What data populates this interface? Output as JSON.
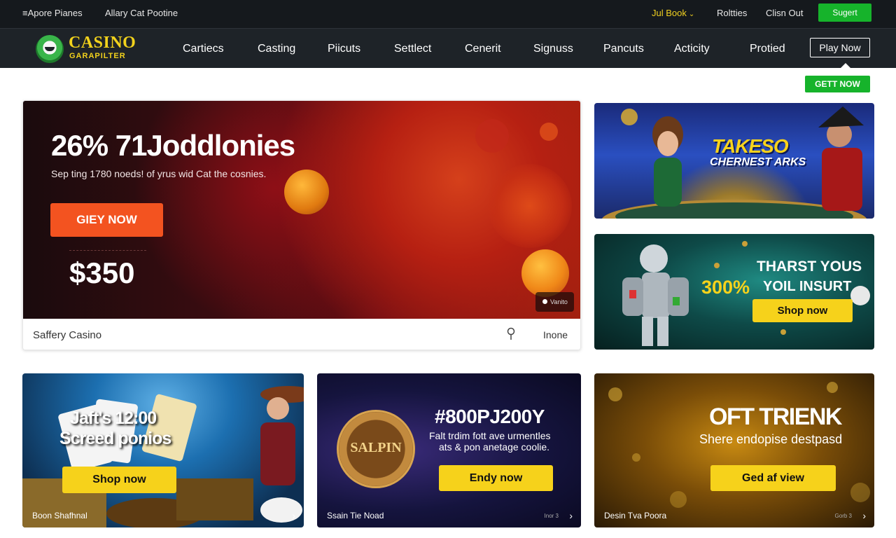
{
  "topbar": {
    "left1": "≡Apore Pianes",
    "left2": "Allary Cat Pootine",
    "lang": "Jul Book",
    "right1": "Roltties",
    "right2": "Clisn Out",
    "signup": "Sugert"
  },
  "brand": {
    "line1": "CASINO",
    "line2": "GARAPILTER",
    "accent": "#f2d21c"
  },
  "nav": {
    "items": [
      "Cartiecs",
      "Casting",
      "Piicuts",
      "Settlect",
      "Cenerit",
      "Signuss",
      "Pancuts",
      "Acticity",
      "Protied"
    ],
    "play_now": "Play Now"
  },
  "get_now": "GETT NOW",
  "hero": {
    "title": "26%  71Joddlonies",
    "subtitle": "Sep ting 1780 noeds! of yrus wid Cat the cosnies.",
    "cta": "GIEY NOW",
    "amount": "$350",
    "badge": "Vanito",
    "footer_name": "Saffery Casino",
    "footer_right": "Inone",
    "cta_color": "#f35320"
  },
  "promo1": {
    "title": "TAKESO",
    "subtitle": "CHERNEST ARKS"
  },
  "promo2": {
    "line1": "THARST YOUS",
    "percent": "300%",
    "line2": "YOIL INSURT",
    "button": "Shop now"
  },
  "cards": [
    {
      "h1": "Jaft's 12:00",
      "h2": "Screed ponios",
      "button": "Shop now",
      "caption": "Boon Shafhnal",
      "mini": ""
    },
    {
      "coin": "SALPIN",
      "heading": "#800PJ200Y",
      "p1": "Falt trdim fott ave urmentles",
      "p2": "ats & pon anetage coolie.",
      "button": "Endy now",
      "caption": "Ssain Tie Noad",
      "mini": "Inor 3"
    },
    {
      "heading": "OFT TRIENK",
      "sub": "Shere endopise destpasd",
      "button": "Ged af view",
      "caption": "Desin Tva Poora",
      "mini": "Gorb 3"
    }
  ],
  "colors": {
    "green": "#16b32b",
    "yellow": "#f6d21b",
    "nav_bg": "#1e2328"
  }
}
